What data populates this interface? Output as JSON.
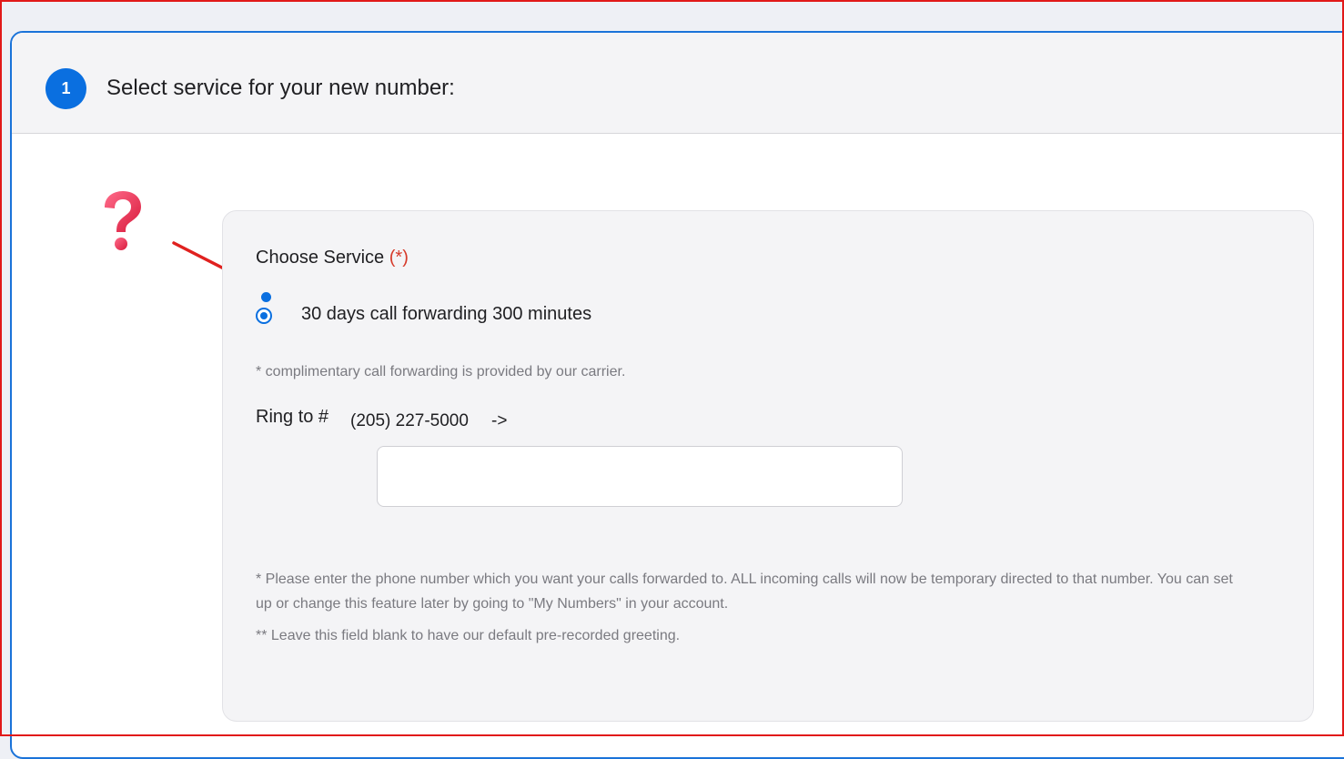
{
  "step": {
    "number": "1",
    "title": "Select service for your new number:"
  },
  "service": {
    "label": "Choose Service",
    "required_marker": "(*)",
    "option_label": "30 days call forwarding 300 minutes",
    "selected": true,
    "carrier_note": "* complimentary call forwarding is provided by our carrier."
  },
  "ring_to": {
    "label": "Ring to #",
    "number": "(205) 227-5000",
    "arrow": "->",
    "input_value": "",
    "input_placeholder": ""
  },
  "notes": {
    "forward_note": "* Please enter the phone number which you want your calls forwarded to. ALL incoming calls will now be temporary directed to that number. You can set up or change this feature later by going to \"My Numbers\" in your account.",
    "blank_note": "** Leave this field blank to have our default pre-recorded greeting."
  },
  "annotations": {
    "help_icon": "question-mark-icon",
    "arrow_icon": "red-arrow-icon"
  },
  "colors": {
    "accent": "#0a6fe0",
    "required": "#d63a2a",
    "annotation_red": "#e11919"
  }
}
